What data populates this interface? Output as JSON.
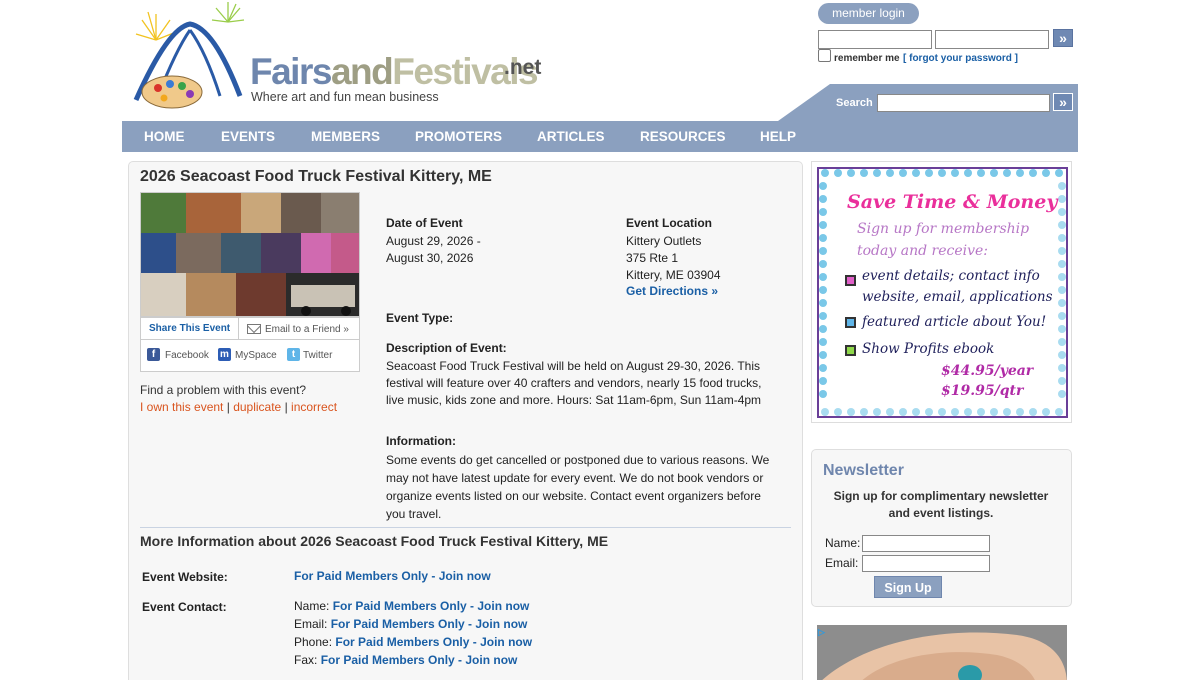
{
  "header": {
    "logo": {
      "word1": "Fairs",
      "word2": "and",
      "word3": "Festivals",
      "suffix": ".net",
      "tagline": "Where art and fun mean business"
    },
    "login": {
      "tab_label": "member login",
      "username_value": "",
      "password_value": "",
      "submit_glyph": "»",
      "remember_label": "remember me",
      "forgot_label": "[ forgot your password ]"
    },
    "search": {
      "label": "Search",
      "value": "",
      "submit_glyph": "»"
    }
  },
  "nav": {
    "items": [
      "HOME",
      "EVENTS",
      "MEMBERS",
      "PROMOTERS",
      "ARTICLES",
      "RESOURCES",
      "HELP"
    ]
  },
  "event": {
    "title": "2026 Seacoast Food Truck Festival Kittery, ME",
    "share": {
      "title": "Share This Event",
      "email": "Email to a Friend »",
      "facebook": "Facebook",
      "myspace": "MySpace",
      "twitter": "Twitter"
    },
    "problem": {
      "question": "Find a problem with this event?",
      "own": "I own this event",
      "sep": " | ",
      "duplicate": "duplicate",
      "incorrect": "incorrect"
    },
    "date": {
      "label": "Date of Event",
      "line1": "August 29, 2026 -",
      "line2": "August 30, 2026"
    },
    "location": {
      "label": "Event Location",
      "venue": "Kittery Outlets",
      "street": "375 Rte 1",
      "city": "Kittery, ME 03904",
      "directions": "Get Directions »"
    },
    "type_label": "Event Type:",
    "description": {
      "label": "Description of Event:",
      "line1": "Seacoast Food Truck Festival will be held on August 29-30, 2026. This",
      "line2": "festival will feature over 40 crafters and vendors, nearly 15 food trucks,",
      "line3": "live music, kids zone and more. Hours: Sat 11am-6pm, Sun 11am-4pm"
    },
    "information": {
      "label": "Information:",
      "line1": "Some events do get cancelled or postponed due to various reasons. We",
      "line2": "may not have latest update for every event. We do not book vendors or",
      "line3": "organize events listed on our website. Contact event organizers before",
      "line4": "you travel."
    },
    "more_title": "More Information about 2026 Seacoast Food Truck Festival Kittery, ME",
    "website": {
      "label": "Event Website:",
      "value": "For Paid Members Only - Join now"
    },
    "contact": {
      "label": "Event Contact:",
      "name_label": "Name:",
      "email_label": "Email:",
      "phone_label": "Phone:",
      "fax_label": "Fax:",
      "locked_value": "For Paid Members Only - Join now"
    }
  },
  "sidebar": {
    "promo": {
      "title": "Save Time & Money",
      "sub1": "Sign up for membership",
      "sub2": "today and receive:",
      "item1a": "event details; contact info",
      "item1b": "website, email, applications",
      "item2": "featured article about You!",
      "item3": "Show Profits ebook",
      "price1": "$44.95/year",
      "price2": "$19.95/qtr"
    },
    "newsletter": {
      "title": "Newsletter",
      "desc1": "Sign up for complimentary newsletter",
      "desc2": "and event listings.",
      "name_label": "Name:",
      "email_label": "Email:",
      "button": "Sign Up"
    }
  },
  "colors": {
    "nav_bg": "#8ba0bf",
    "link": "#1a5fa5",
    "orange_link": "#d9541e",
    "panel_bg": "#f7f7f7"
  }
}
